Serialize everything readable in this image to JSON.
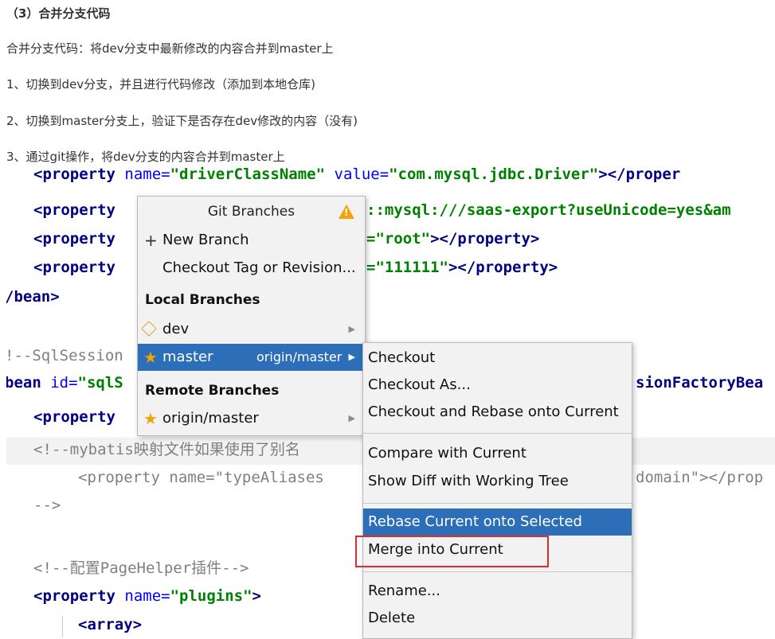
{
  "doc": {
    "heading": "（3）合并分支代码",
    "intro": "合并分支代码：将dev分支中最新修改的内容合并到master上",
    "step1": "1、切换到dev分支，并且进行代码修改（添加到本地仓库)",
    "step2": "2、切换到master分支上，验证下是否存在dev修改的内容（没有)",
    "step3": "3、通过git操作，将dev分支的内容合并到master上"
  },
  "code": {
    "l0_tag": "<property",
    "l0_rest_attr": " name=",
    "l0_rest_val": "\"driverClassName\"",
    "l0_attr2": " value=",
    "l0_val2": "\"com.mysql.jdbc.Driver\"",
    "l0_end": "></proper",
    "l1_tag": "<property",
    "l1_val": "::mysql:///saas-export?useUnicode=yes&am",
    "l2_tag": "<property",
    "l2_val": "=\"root\"",
    "l2_end": "></property>",
    "l3_tag": "<property",
    "l3_val": "=\"111111\"",
    "l3_end": "></property>",
    "l4": "/bean>",
    "l5": "!--SqlSession",
    "l6_tag": "bean",
    "l6_attr": " id=",
    "l6_val": "\"sqlS",
    "l6_right": "sionFactoryBea",
    "l7_tag": "<property",
    "l8": "<!--mybatis映射文件如果使用了别名",
    "l9_left": "<property name=\"typeAliases",
    "l9_right": "domain\"></prop",
    "l10": "-->",
    "l11": "<!--配置PageHelper插件-->",
    "l12_tag": "<property",
    "l12_attr": " name=",
    "l12_val": "\"plugins\"",
    "l12_end": ">",
    "l13": "<array>"
  },
  "popup": {
    "title": "Git Branches",
    "warning_icon": "warning-icon",
    "new_branch": "New Branch",
    "checkout_tag": "Checkout Tag or Revision...",
    "local_section": "Local Branches",
    "local": [
      {
        "name": "dev",
        "icon": "tag-icon"
      },
      {
        "name": "master",
        "icon": "star-icon",
        "upstream": "origin/master"
      }
    ],
    "remote_section": "Remote Branches",
    "remote": [
      {
        "name": "origin/master",
        "icon": "star-icon"
      }
    ]
  },
  "submenu": {
    "items": [
      "Checkout",
      "Checkout As...",
      "Checkout and Rebase onto Current",
      "Compare with Current",
      "Show Diff with Working Tree",
      "Rebase Current onto Selected",
      "Merge into Current",
      "Rename...",
      "Delete"
    ],
    "highlighted": "Rebase Current onto Selected",
    "annotated": "Merge into Current"
  },
  "colors": {
    "selection": "#2d6eb8",
    "annotation": "#e02b2b",
    "star": "#f0a30a"
  }
}
